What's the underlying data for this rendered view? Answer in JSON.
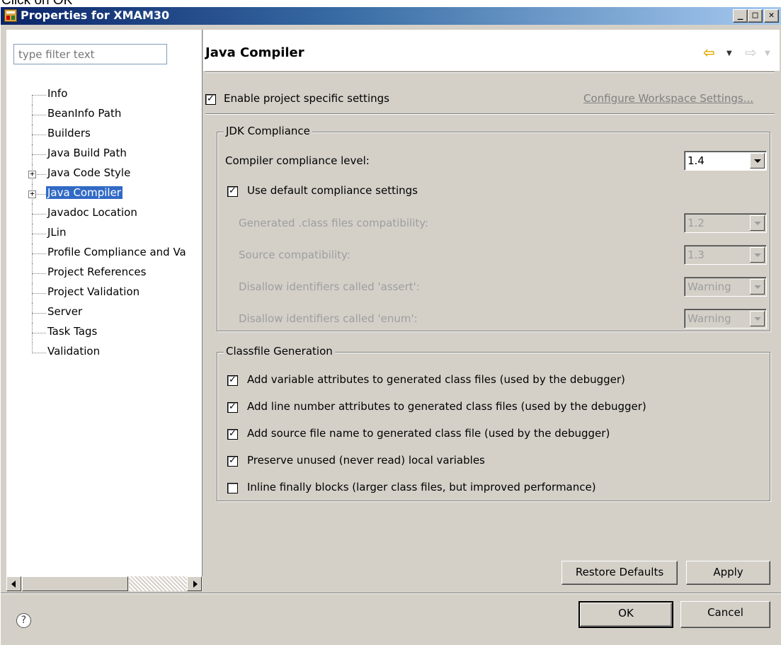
{
  "caption": "Click on OK",
  "window": {
    "title": "Properties for XMAM30",
    "controls": {
      "minimize": "_",
      "maximize": "□",
      "close": "✕"
    }
  },
  "left": {
    "filter_placeholder": "type filter text",
    "tree": [
      {
        "label": "Info",
        "expandable": false,
        "selected": false
      },
      {
        "label": "BeanInfo Path",
        "expandable": false,
        "selected": false
      },
      {
        "label": "Builders",
        "expandable": false,
        "selected": false
      },
      {
        "label": "Java Build Path",
        "expandable": false,
        "selected": false
      },
      {
        "label": "Java Code Style",
        "expandable": true,
        "selected": false
      },
      {
        "label": "Java Compiler",
        "expandable": true,
        "selected": true
      },
      {
        "label": "Javadoc Location",
        "expandable": false,
        "selected": false
      },
      {
        "label": "JLin",
        "expandable": false,
        "selected": false
      },
      {
        "label": "Profile Compliance and Va",
        "expandable": false,
        "selected": false
      },
      {
        "label": "Project References",
        "expandable": false,
        "selected": false
      },
      {
        "label": "Project Validation",
        "expandable": false,
        "selected": false
      },
      {
        "label": "Server",
        "expandable": false,
        "selected": false
      },
      {
        "label": "Task Tags",
        "expandable": false,
        "selected": false
      },
      {
        "label": "Validation",
        "expandable": false,
        "selected": false
      }
    ]
  },
  "right": {
    "title": "Java Compiler",
    "enable_project_specific": {
      "label": "Enable project specific settings",
      "checked": true
    },
    "configure_link": "Configure Workspace Settings...",
    "jdk": {
      "legend": "JDK Compliance",
      "compliance_label": "Compiler compliance level:",
      "compliance_value": "1.4",
      "use_default": {
        "label": "Use default compliance settings",
        "checked": true
      },
      "rows": [
        {
          "label": "Generated .class files compatibility:",
          "value": "1.2"
        },
        {
          "label": "Source compatibility:",
          "value": "1.3"
        },
        {
          "label": "Disallow identifiers called 'assert':",
          "value": "Warning"
        },
        {
          "label": "Disallow identifiers called 'enum':",
          "value": "Warning"
        }
      ]
    },
    "classfile": {
      "legend": "Classfile Generation",
      "options": [
        {
          "label": "Add variable attributes to generated class files (used by the debugger)",
          "checked": true
        },
        {
          "label": "Add line number attributes to generated class files (used by the debugger)",
          "checked": true
        },
        {
          "label": "Add source file name to generated class file (used by the debugger)",
          "checked": true
        },
        {
          "label": "Preserve unused (never read) local variables",
          "checked": true
        },
        {
          "label": "Inline finally blocks (larger class files, but improved performance)",
          "checked": false
        }
      ]
    },
    "restore_defaults": "Restore Defaults",
    "apply": "Apply"
  },
  "footer": {
    "help": "?",
    "ok": "OK",
    "cancel": "Cancel"
  }
}
